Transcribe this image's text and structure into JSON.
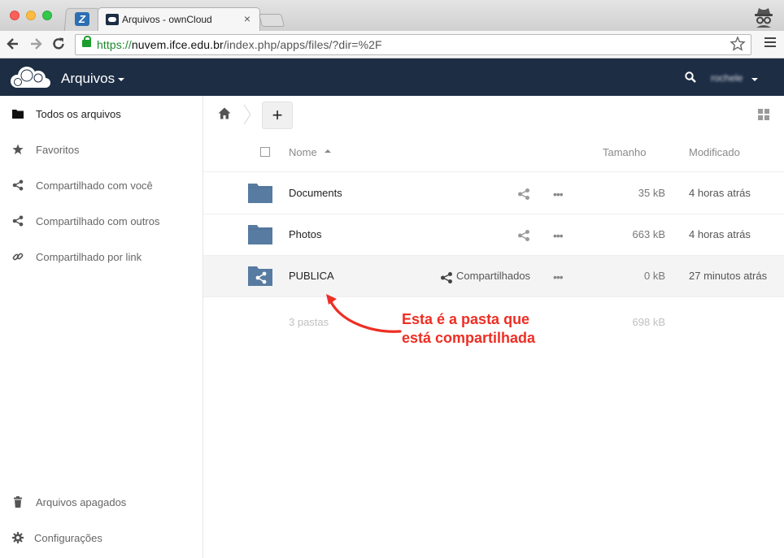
{
  "browser": {
    "tab_title": "Arquivos - ownCloud",
    "tab_close": "×",
    "url_scheme": "https://",
    "url_host": "nuvem.ifce.edu.br",
    "url_path": "/index.php/apps/files/?dir=%2F",
    "icons": [
      "back-arrow-icon",
      "forward-arrow-icon",
      "reload-icon",
      "lock-icon",
      "star-icon",
      "menu-icon",
      "incognito-icon"
    ]
  },
  "header": {
    "app_name": "Arquivos",
    "user_name": "rochele",
    "bg_color": "#1d2d44"
  },
  "sidebar": {
    "items": [
      {
        "label": "Todos os arquivos",
        "icon": "folder-icon"
      },
      {
        "label": "Favoritos",
        "icon": "star-icon"
      },
      {
        "label": "Compartilhado com você",
        "icon": "share-icon"
      },
      {
        "label": "Compartilhado com outros",
        "icon": "share-icon"
      },
      {
        "label": "Compartilhado por link",
        "icon": "link-icon"
      }
    ],
    "bottom_items": [
      {
        "label": "Arquivos apagados",
        "icon": "trash-icon"
      },
      {
        "label": "Configurações",
        "icon": "gear-icon"
      }
    ]
  },
  "toolbar": {
    "new_label": "+"
  },
  "table": {
    "columns": {
      "name": "Nome",
      "size": "Tamanho",
      "modified": "Modificado"
    },
    "rows": [
      {
        "name": "Documents",
        "size": "35 kB",
        "modified": "4 horas atrás",
        "shared": false
      },
      {
        "name": "Photos",
        "size": "663 kB",
        "modified": "4 horas atrás",
        "shared": false
      },
      {
        "name": "PUBLICA",
        "size": "0 kB",
        "modified": "27 minutos atrás",
        "shared": true,
        "shared_label": "Compartilhados"
      }
    ],
    "summary": {
      "count": "3 pastas",
      "total": "698 kB"
    }
  },
  "annotation": {
    "line1": "Esta é a pasta que",
    "line2": "está compartilhada",
    "color": "#ee2e24"
  },
  "colors": {
    "folder": "#587ba1",
    "accent": "#1d2d44"
  }
}
